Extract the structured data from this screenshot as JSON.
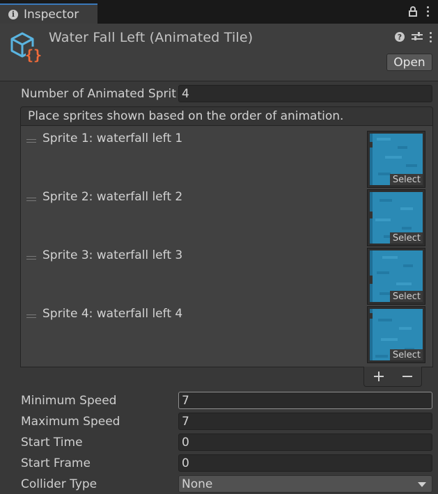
{
  "tab": {
    "label": "Inspector"
  },
  "header": {
    "title": "Water Fall Left (Animated Tile)",
    "open_label": "Open"
  },
  "fields": {
    "num_sprites_label": "Number of Animated Sprit",
    "num_sprites_value": "4",
    "min_speed_label": "Minimum Speed",
    "min_speed_value": "7",
    "max_speed_label": "Maximum Speed",
    "max_speed_value": "7",
    "start_time_label": "Start Time",
    "start_time_value": "0",
    "start_frame_label": "Start Frame",
    "start_frame_value": "0",
    "collider_label": "Collider Type",
    "collider_value": "None"
  },
  "sprite_list": {
    "header": "Place sprites shown based on the order of animation.",
    "items": [
      {
        "label": "Sprite 1: waterfall left 1",
        "select_label": "Select"
      },
      {
        "label": "Sprite 2: waterfall left 2",
        "select_label": "Select"
      },
      {
        "label": "Sprite 3: waterfall left 3",
        "select_label": "Select"
      },
      {
        "label": "Sprite 4: waterfall left 4",
        "select_label": "Select"
      }
    ]
  },
  "icons": {
    "tab": "info-icon",
    "tab_actions": [
      "lock-icon",
      "kebab-menu-icon"
    ],
    "header_actions": [
      "help-icon",
      "preset-sliders-icon",
      "kebab-menu-icon"
    ],
    "asset": "scriptable-object-cube-icon",
    "list_buttons": [
      "plus-icon",
      "minus-icon"
    ]
  },
  "colors": {
    "accent": "#3a79bb",
    "water": "#2b8ab5",
    "asset_icon_brace": "#f06b3a",
    "asset_icon_cube": "#5ab4e0"
  }
}
